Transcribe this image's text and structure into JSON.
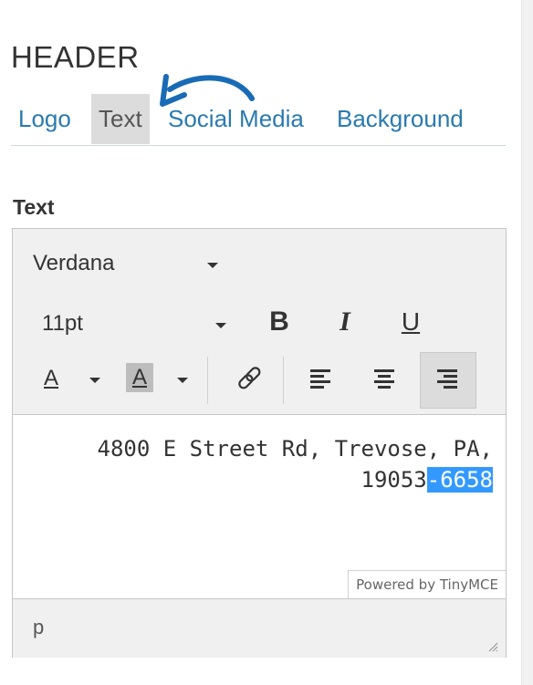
{
  "section": {
    "title": "HEADER"
  },
  "tabs": [
    {
      "label": "Logo"
    },
    {
      "label": "Text",
      "active": true
    },
    {
      "label": "Social Media"
    },
    {
      "label": "Background"
    }
  ],
  "field": {
    "label": "Text"
  },
  "editor": {
    "font_family": "Verdana",
    "font_size": "11pt",
    "buttons": {
      "bold": "B",
      "italic": "I",
      "underline": "U",
      "forecolor": "A",
      "backcolor": "A"
    },
    "content": {
      "line1": "4800 E Street Rd, Trevose, PA,",
      "line2_unselected": "19053",
      "line2_selected": "-6658"
    },
    "powered_by": "Powered by TinyMCE",
    "element_path": "p"
  },
  "colors": {
    "link": "#2a7ab0",
    "active_tab_bg": "#dcdcdc",
    "selection": "#3399ff",
    "annotation_arrow": "#1a6bb5"
  },
  "icons": [
    "dropdown-caret-icon",
    "link-icon",
    "align-left-icon",
    "align-center-icon",
    "align-right-icon",
    "resize-handle-icon",
    "curved-arrow-icon"
  ]
}
